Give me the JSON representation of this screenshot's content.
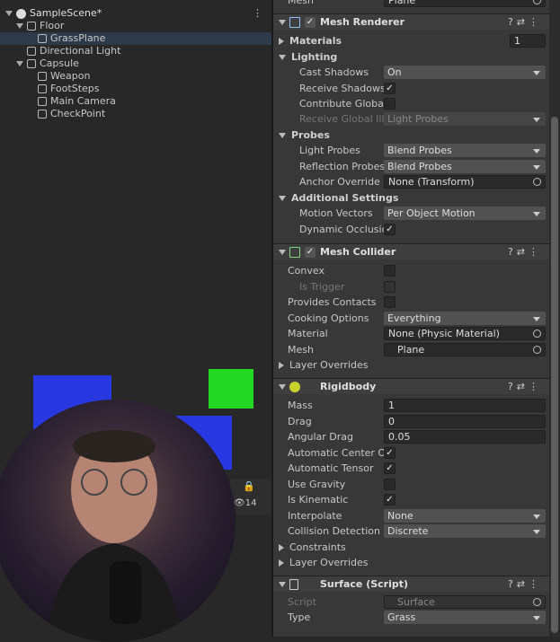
{
  "hierarchy": {
    "scene": "SampleScene*",
    "items": [
      {
        "label": "Floor",
        "level": 1
      },
      {
        "label": "GrassPlane",
        "level": 2
      },
      {
        "label": "Directional Light",
        "level": 1
      },
      {
        "label": "Capsule",
        "level": 1
      },
      {
        "label": "Weapon",
        "level": 2
      },
      {
        "label": "FootSteps",
        "level": 2
      },
      {
        "label": "Main Camera",
        "level": 2
      },
      {
        "label": "CheckPoint",
        "level": 2
      }
    ],
    "hidden_count": "14"
  },
  "inspector": {
    "top_field": {
      "label": "Mesh",
      "value": "Plane"
    },
    "mesh_renderer": {
      "title": "Mesh Renderer",
      "materials_label": "Materials",
      "materials_count": "1",
      "lighting_label": "Lighting",
      "cast_shadows_label": "Cast Shadows",
      "cast_shadows": "On",
      "receive_shadows_label": "Receive Shadows",
      "contribute_gi_label": "Contribute Global I",
      "receive_gi_label": "Receive Global Illu",
      "receive_gi": "Light Probes",
      "probes_label": "Probes",
      "light_probes_label": "Light Probes",
      "light_probes": "Blend Probes",
      "reflection_probes_label": "Reflection Probes",
      "reflection_probes": "Blend Probes",
      "anchor_override_label": "Anchor Override",
      "anchor_override": "None (Transform)",
      "additional_label": "Additional Settings",
      "motion_vectors_label": "Motion Vectors",
      "motion_vectors": "Per Object Motion",
      "dynamic_occlusion_label": "Dynamic Occlusio"
    },
    "mesh_collider": {
      "title": "Mesh Collider",
      "convex_label": "Convex",
      "is_trigger_label": "Is Trigger",
      "provides_contacts_label": "Provides Contacts",
      "cooking_options_label": "Cooking Options",
      "cooking_options": "Everything",
      "material_label": "Material",
      "material": "None (Physic Material)",
      "mesh_label": "Mesh",
      "mesh": "Plane",
      "layer_overrides_label": "Layer Overrides"
    },
    "rigidbody": {
      "title": "Rigidbody",
      "mass_label": "Mass",
      "mass": "1",
      "drag_label": "Drag",
      "drag": "0",
      "angular_drag_label": "Angular Drag",
      "angular_drag": "0.05",
      "auto_center_label": "Automatic Center Of I",
      "auto_tensor_label": "Automatic Tensor",
      "use_gravity_label": "Use Gravity",
      "is_kinematic_label": "Is Kinematic",
      "interpolate_label": "Interpolate",
      "interpolate": "None",
      "collision_label": "Collision Detection",
      "collision": "Discrete",
      "constraints_label": "Constraints",
      "layer_overrides_label": "Layer Overrides"
    },
    "surface": {
      "title": "Surface (Script)",
      "script_label": "Script",
      "script": "Surface",
      "type_label": "Type",
      "type": "Grass"
    }
  }
}
